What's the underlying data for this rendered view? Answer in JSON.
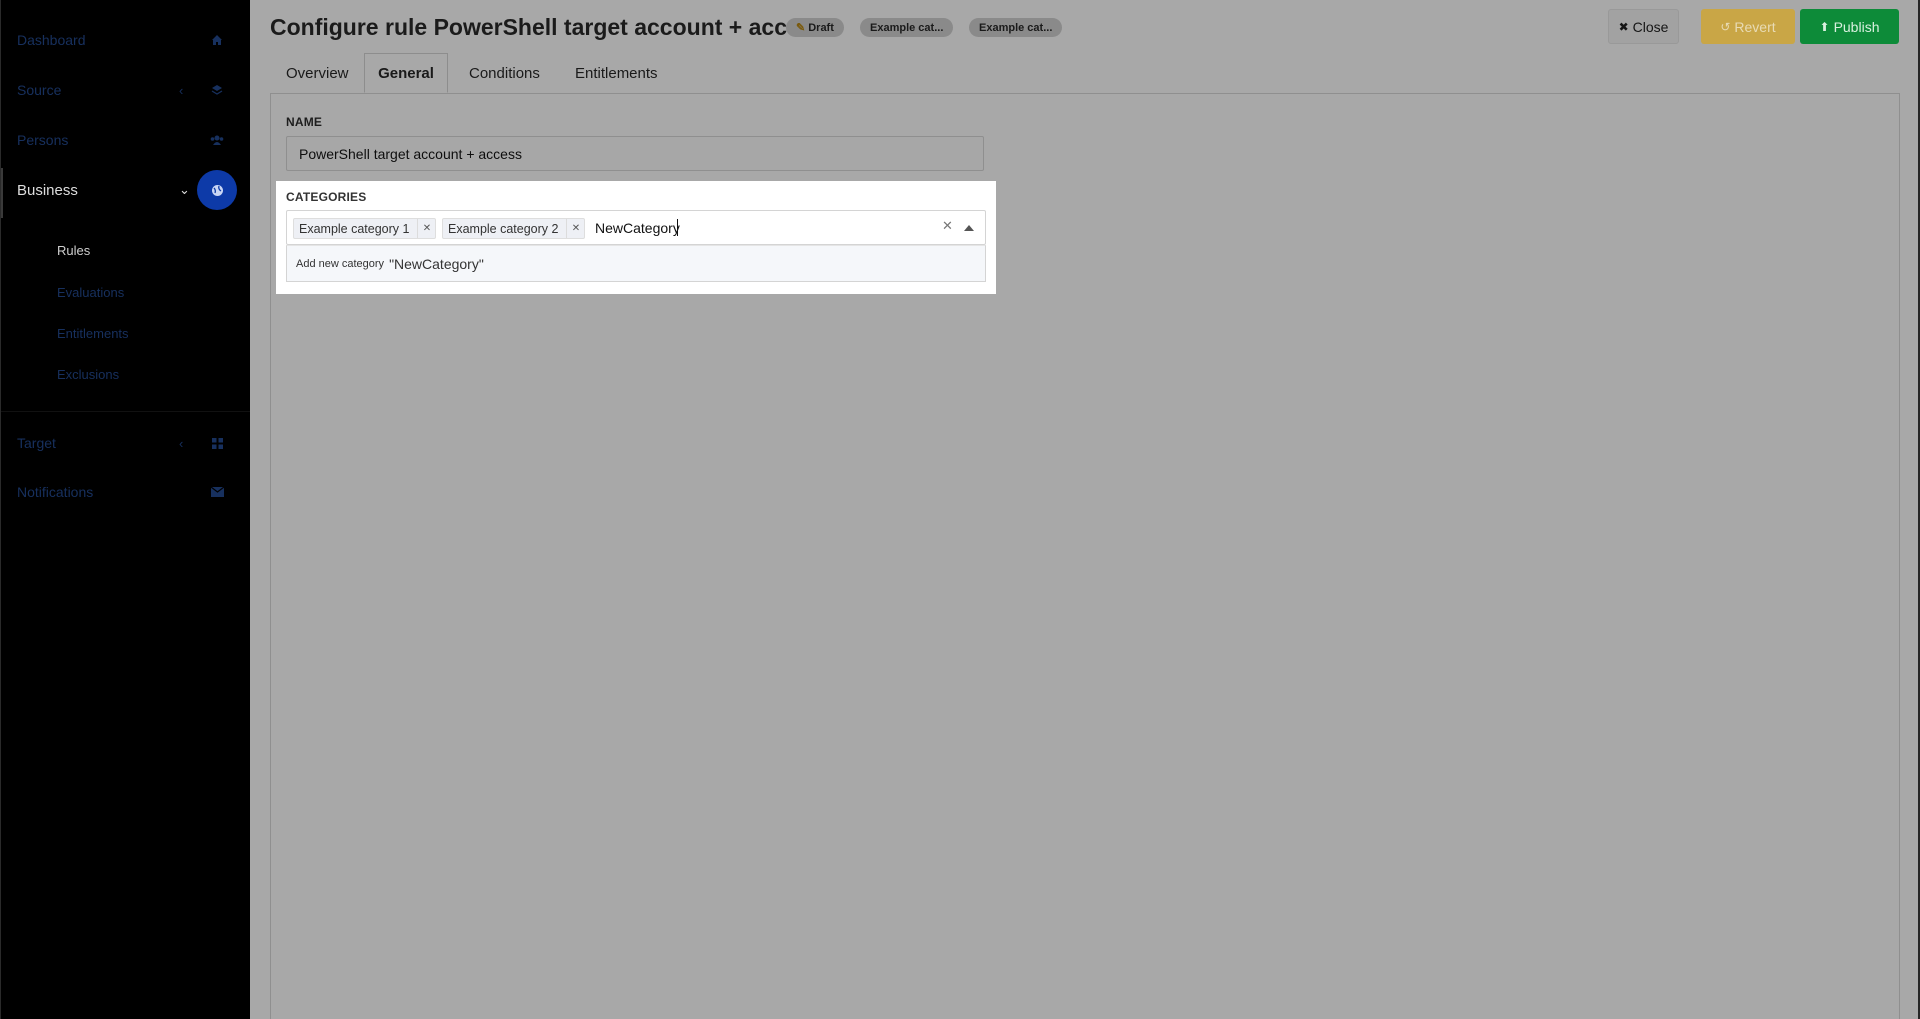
{
  "sidebar": {
    "items": [
      {
        "label": "Dashboard",
        "icon": "home-icon"
      },
      {
        "label": "Source",
        "icon": "layers-icon"
      },
      {
        "label": "Persons",
        "icon": "users-icon"
      },
      {
        "label": "Business",
        "icon": "globe-icon"
      },
      {
        "label": "Target",
        "icon": "grid-icon"
      },
      {
        "label": "Notifications",
        "icon": "envelope-icon"
      }
    ],
    "business_sub": [
      "Rules",
      "Evaluations",
      "Entitlements",
      "Exclusions"
    ]
  },
  "header": {
    "title_prefix": "Configure rule",
    "title_name": "PowerShell target account + access",
    "badges": [
      "Draft",
      "Example cat...",
      "Example cat..."
    ]
  },
  "actions": {
    "close": "Close",
    "revert": "Revert",
    "publish": "Publish"
  },
  "tabs": [
    "Overview",
    "General",
    "Conditions",
    "Entitlements"
  ],
  "form": {
    "name_label": "NAME",
    "name_value": "PowerShell target account + access",
    "categories_label": "CATEGORIES",
    "chips": [
      "Example category 1",
      "Example category 2"
    ],
    "typed_value": "NewCategory",
    "option_prefix": "Add new category",
    "option_value": "\"NewCategory\""
  },
  "colors": {
    "accent": "#0d3aa8",
    "revert": "#c9a646",
    "publish": "#0d8b39"
  }
}
